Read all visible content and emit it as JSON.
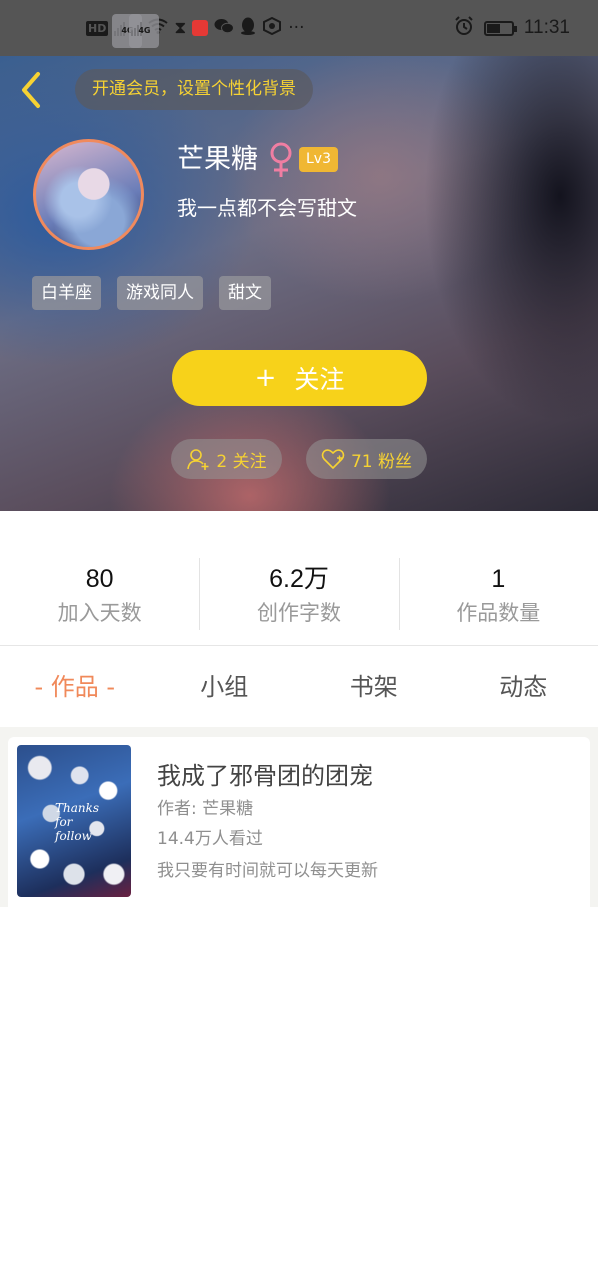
{
  "status_bar": {
    "time": "11:31",
    "hd_label": "HD",
    "signal1_tag": "4G",
    "signal2_tag": "4G",
    "overflow": "···",
    "battery_percent": 55
  },
  "header": {
    "back_icon": "chevron-left-icon",
    "vip_prompt": "开通会员，设置个性化背景",
    "username": "芒果糖",
    "gender_icon": "female-icon",
    "level": "Lv3",
    "bio": "我一点都不会写甜文",
    "tags": [
      "白羊座",
      "游戏同人",
      "甜文"
    ],
    "follow_button": {
      "plus": "+",
      "label": "关注"
    },
    "following": "2 关注",
    "fans": "71 粉丝",
    "colors": {
      "accent_yellow": "#f7d21a",
      "pill_text": "#f6d233",
      "avatar_border": "#f08a5d"
    }
  },
  "stats": [
    {
      "value": "80",
      "label": "加入天数"
    },
    {
      "value": "6.2万",
      "label": "创作字数"
    },
    {
      "value": "1",
      "label": "作品数量"
    }
  ],
  "tabs": [
    {
      "label": "- 作品 -",
      "active": true
    },
    {
      "label": "小组",
      "active": false
    },
    {
      "label": "书架",
      "active": false
    },
    {
      "label": "动态",
      "active": false
    }
  ],
  "works": [
    {
      "title": "我成了邪骨团的团宠",
      "author": "作者: 芒果糖",
      "views": "14.4万人看过",
      "description": "我只要有时间就可以每天更新",
      "cover_text": "Thanks\nfor\nfollow"
    }
  ]
}
